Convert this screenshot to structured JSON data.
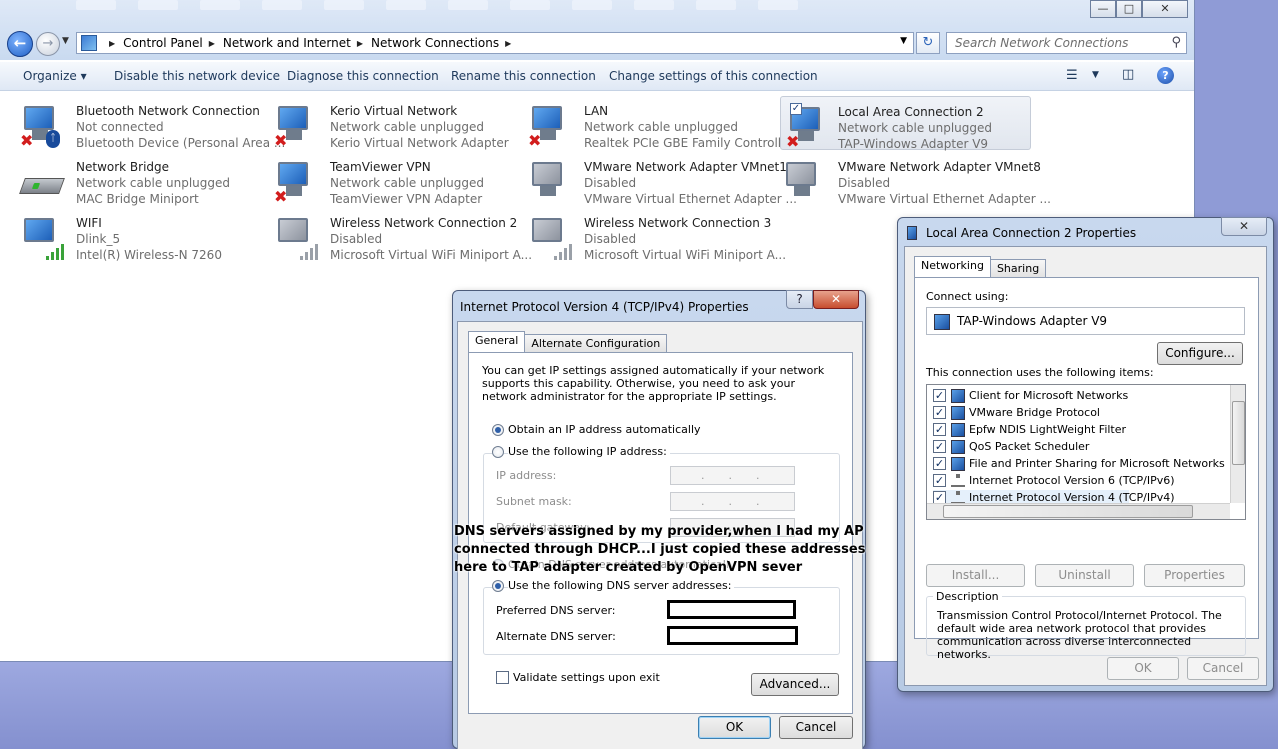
{
  "explorer": {
    "window_controls": {
      "minimize": "—",
      "maximize": "□",
      "close": "✕"
    },
    "breadcrumbs": [
      "Control Panel",
      "Network and Internet",
      "Network Connections"
    ],
    "search_placeholder": "Search Network Connections",
    "commands": [
      "Organize ▾",
      "Disable this network device",
      "Diagnose this connection",
      "Rename this connection",
      "Change settings of this connection"
    ],
    "help_label": "?",
    "connections": [
      {
        "name": "Bluetooth Network Connection",
        "status": "Not connected",
        "device": "Bluetooth Device (Personal Area ...",
        "icon": "bluetooth",
        "x_mark": true
      },
      {
        "name": "Kerio Virtual Network",
        "status": "Network cable unplugged",
        "device": "Kerio Virtual Network Adapter",
        "icon": "monitor",
        "x_mark": true
      },
      {
        "name": "LAN",
        "status": "Network cable unplugged",
        "device": "Realtek PCIe GBE Family Controller",
        "icon": "monitor",
        "x_mark": true
      },
      {
        "name": "Local Area Connection 2",
        "status": "Network cable unplugged",
        "device": "TAP-Windows Adapter V9",
        "icon": "monitor",
        "x_mark": true,
        "selected": true
      },
      {
        "name": "Network Bridge",
        "status": "Network cable unplugged",
        "device": "MAC Bridge Miniport",
        "icon": "router"
      },
      {
        "name": "TeamViewer VPN",
        "status": "Network cable unplugged",
        "device": "TeamViewer VPN Adapter",
        "icon": "monitor",
        "x_mark": true
      },
      {
        "name": "VMware Network Adapter VMnet1",
        "status": "Disabled",
        "device": "VMware Virtual Ethernet Adapter ...",
        "icon": "monitor-disabled"
      },
      {
        "name": "VMware Network Adapter VMnet8",
        "status": "Disabled",
        "device": "VMware Virtual Ethernet Adapter ...",
        "icon": "monitor-disabled"
      },
      {
        "name": "WIFI",
        "status": "Dlink_5",
        "device": "Intel(R) Wireless-N 7260",
        "icon": "wifi-connected"
      },
      {
        "name": "Wireless Network Connection 2",
        "status": "Disabled",
        "device": "Microsoft Virtual WiFi Miniport A...",
        "icon": "wifi-disabled"
      },
      {
        "name": "Wireless Network Connection 3",
        "status": "Disabled",
        "device": "Microsoft Virtual WiFi Miniport A...",
        "icon": "wifi-disabled"
      }
    ]
  },
  "ipv4": {
    "title": "Internet Protocol Version 4 (TCP/IPv4) Properties",
    "help": "?",
    "close": "✕",
    "tabs": [
      "General",
      "Alternate Configuration"
    ],
    "intro": "You can get IP settings assigned automatically if your network supports this capability. Otherwise, you need to ask your network administrator for the appropriate IP settings.",
    "obtain_ip": "Obtain an IP address automatically",
    "use_ip": "Use the following IP address:",
    "ip_label": "IP address:",
    "subnet_label": "Subnet mask:",
    "gateway_label": "Default gateway:",
    "obtain_dns": "Obtain DNS server address automatically",
    "use_dns": "Use the following DNS server addresses:",
    "preferred_dns": "Preferred DNS server:",
    "alternate_dns": "Alternate DNS server:",
    "validate": "Validate settings upon exit",
    "advanced": "Advanced...",
    "ok": "OK",
    "cancel": "Cancel",
    "ip_dots": "...",
    "selected_ip_mode": "automatic",
    "selected_dns_mode": "manual"
  },
  "annotation": "DNS servers assigned by my provider,when I had my AP connected through DHCP...I just copied these addresses here to TAP adapter created by OpenVPN sever",
  "props": {
    "title": "Local Area Connection 2 Properties",
    "close": "✕",
    "tabs": [
      "Networking",
      "Sharing"
    ],
    "connect_using": "Connect using:",
    "adapter": "TAP-Windows Adapter V9",
    "configure": "Configure...",
    "items_label": "This connection uses the following items:",
    "items": [
      {
        "label": "Client for Microsoft Networks",
        "checked": true,
        "icon": "network"
      },
      {
        "label": "VMware Bridge Protocol",
        "checked": true,
        "icon": "network"
      },
      {
        "label": "Epfw NDIS LightWeight Filter",
        "checked": true,
        "icon": "network"
      },
      {
        "label": "QoS Packet Scheduler",
        "checked": true,
        "icon": "network"
      },
      {
        "label": "File and Printer Sharing for Microsoft Networks",
        "checked": true,
        "icon": "network"
      },
      {
        "label": "Internet Protocol Version 6 (TCP/IPv6)",
        "checked": true,
        "icon": "protocol"
      },
      {
        "label": "Internet Protocol Version 4 (TCP/IPv4)",
        "checked": true,
        "icon": "protocol"
      }
    ],
    "install": "Install...",
    "uninstall": "Uninstall",
    "properties": "Properties",
    "description_label": "Description",
    "description": "Transmission Control Protocol/Internet Protocol. The default wide area network protocol that provides communication across diverse interconnected networks.",
    "ok": "OK",
    "cancel": "Cancel"
  }
}
